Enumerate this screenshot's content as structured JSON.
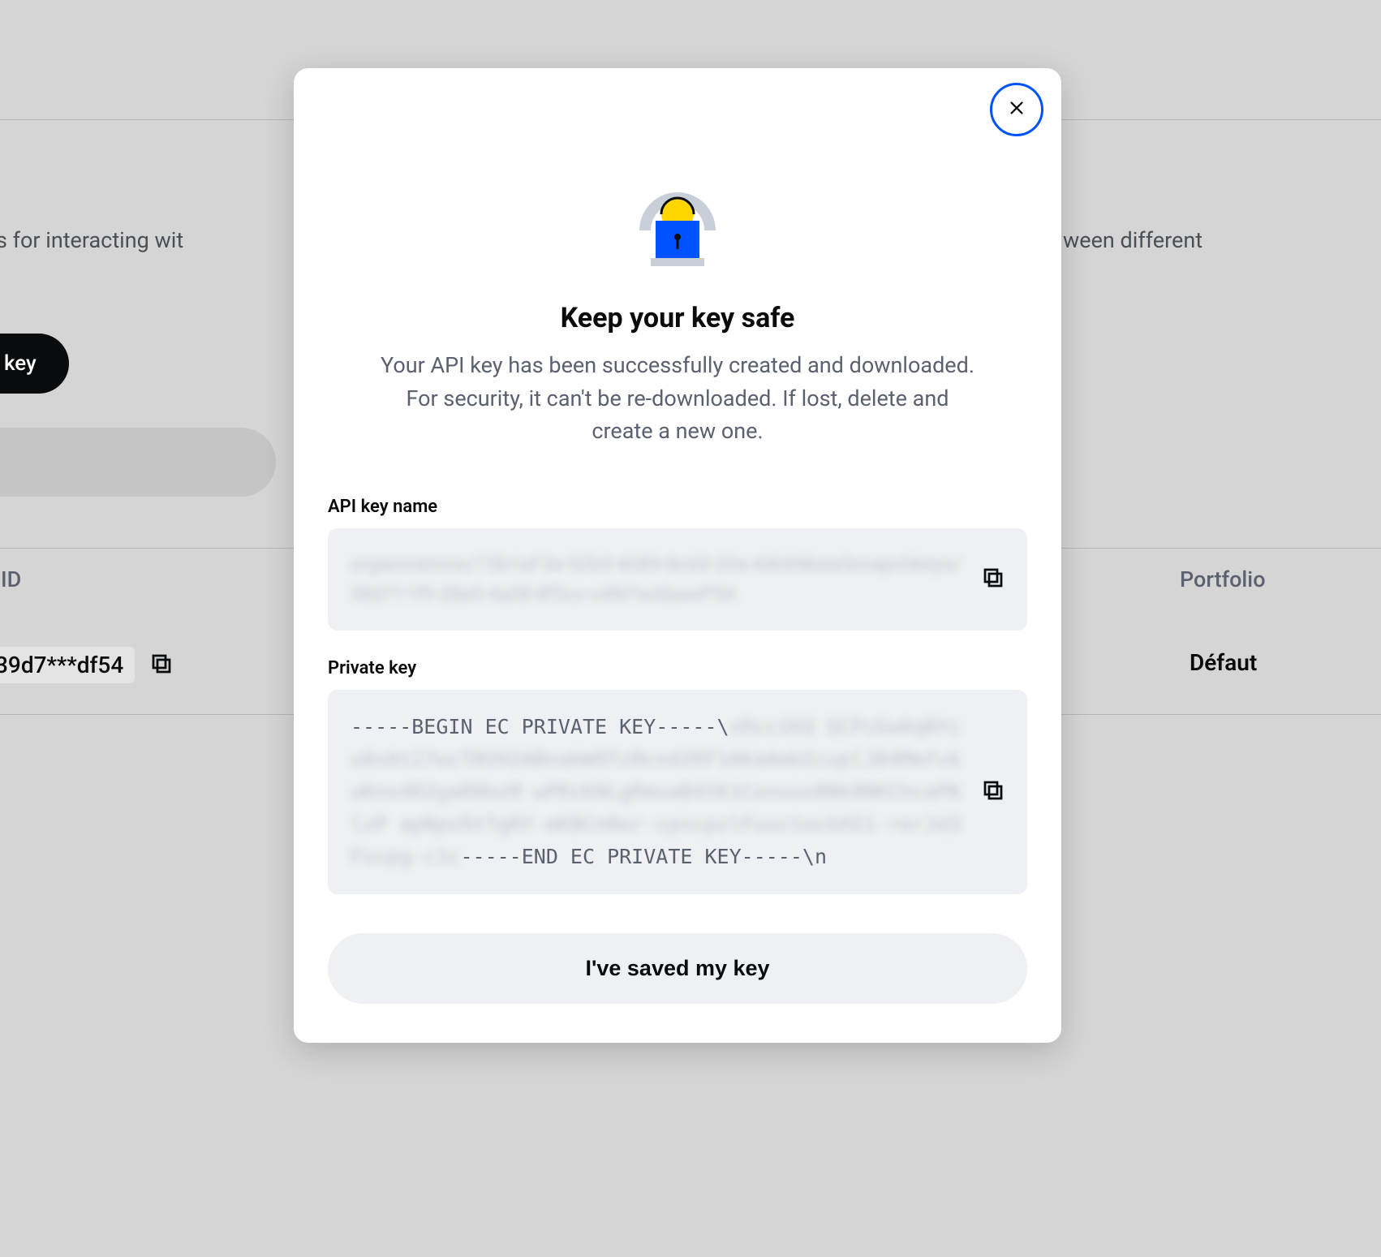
{
  "background": {
    "description_left": "missions for interacting wit",
    "description_right": "ween different",
    "trading_key_button": "ding key",
    "table": {
      "header_key_id": "Key ID",
      "header_portfolio": "Portfolio",
      "row_key_id": "39d7***df54",
      "row_portfolio": "Défaut"
    }
  },
  "modal": {
    "title": "Keep your key safe",
    "description": "Your API key has been successfully created and downloaded. For security, it can't be re-downloaded. If lost, delete and create a new one.",
    "api_key_name_label": "API key name",
    "api_key_name_value_blurred": "organizations/73b1aF3e-52b3-4089-8c60-20a-AWANbea5ecapchkeys/38d711f9-28e0-4a08-8f3cc-c4N7wAbawP5A",
    "private_key_label": "Private key",
    "private_key_begin": "-----BEGIN EC PRIVATE KEY-----\\",
    "private_key_blurred": "xRcc1KQ QCPcGwAqBYcu0xAt27wcTNVH2ABnabW9TcMcnd2RF1AKaAmbIcuplJB4MmfvkuKns4R2gaR0bzM wPRcKNLgRmuaB4YK1ConuusBNk8NKChcaPKlzP apNpcRtTgRY-mKBCnBor-cpxcpzlFuxctockHI1-rerJd3Fscpg-c1c",
    "private_key_end": "-----END EC PRIVATE KEY-----\\n",
    "saved_button": "I've saved my key"
  }
}
